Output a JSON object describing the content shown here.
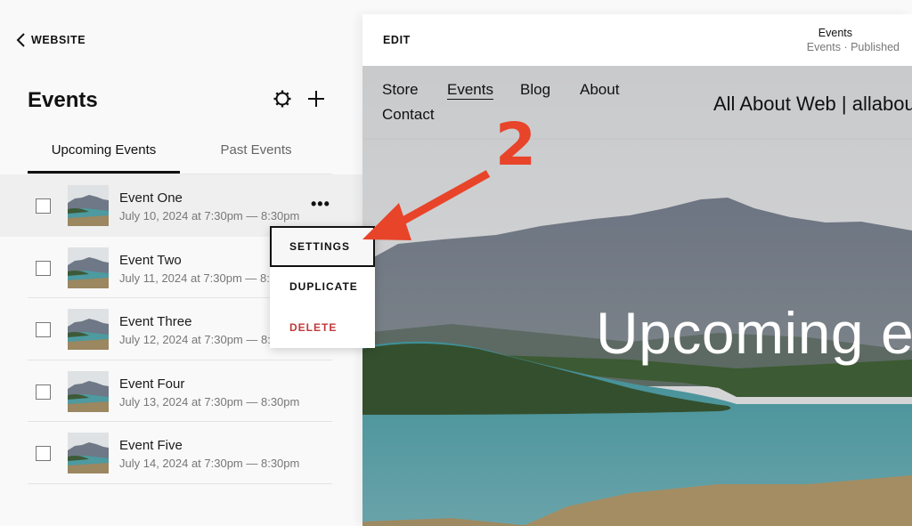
{
  "sidebar": {
    "back_label": "WEBSITE",
    "title": "Events",
    "tabs": [
      {
        "label": "Upcoming Events",
        "active": true
      },
      {
        "label": "Past Events",
        "active": false
      }
    ],
    "events": [
      {
        "name": "Event One",
        "date": "July 10, 2024 at 7:30pm — 8:30pm"
      },
      {
        "name": "Event Two",
        "date": "July 11, 2024 at 7:30pm — 8:30pm"
      },
      {
        "name": "Event Three",
        "date": "July 12, 2024 at 7:30pm — 8:30pm"
      },
      {
        "name": "Event Four",
        "date": "July 13, 2024 at 7:30pm — 8:30pm"
      },
      {
        "name": "Event Five",
        "date": "July 14, 2024 at 7:30pm — 8:30pm"
      }
    ],
    "more_glyph": "•••",
    "context_menu": {
      "items": [
        {
          "label": "SETTINGS",
          "selected": true
        },
        {
          "label": "DUPLICATE",
          "selected": false
        },
        {
          "label": "DELETE",
          "selected": false,
          "color": "#c0393b"
        }
      ]
    }
  },
  "preview": {
    "edit_label": "EDIT",
    "page_title": "Events",
    "page_status": "Events · Published",
    "nav": [
      {
        "label": "Store",
        "current": false
      },
      {
        "label": "Events",
        "current": true
      },
      {
        "label": "Blog",
        "current": false
      },
      {
        "label": "About",
        "current": false
      },
      {
        "label": "Contact",
        "current": false
      }
    ],
    "site_title": "All About Web | allabou",
    "hero_heading": "Upcoming e"
  },
  "annotation": {
    "step_number": "2",
    "color": "#e8442a"
  },
  "icons": {
    "back": "chevron-left-icon",
    "settings": "gear-icon",
    "add": "plus-icon",
    "more": "ellipsis-icon"
  }
}
